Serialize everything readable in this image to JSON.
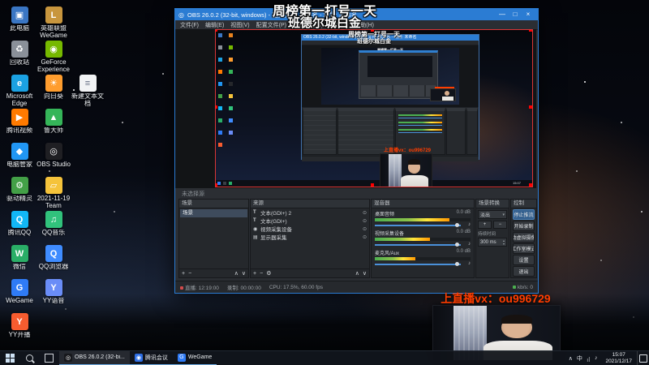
{
  "colors": {
    "accent_blue": "#2b7cd3",
    "vx_red": "#ff3d00",
    "live_red": "#d24b4b",
    "bitrate_green": "#4caf50"
  },
  "overlay": {
    "line1": "周榜第一打号一天",
    "line2": "班德尔城白金"
  },
  "vx": {
    "text": "上直播vx：ou996729"
  },
  "desktop": {
    "col1": [
      {
        "label": "此电脑",
        "glyph": "▣",
        "color": "#3a76c4"
      },
      {
        "label": "回收站",
        "glyph": "♻",
        "color": "#8a9099"
      },
      {
        "label": "Microsoft Edge",
        "glyph": "e",
        "color": "#1ba1e2"
      },
      {
        "label": "腾讯视频",
        "glyph": "▶",
        "color": "#ff7a00"
      },
      {
        "label": "电脑管家",
        "glyph": "◆",
        "color": "#2196f3"
      },
      {
        "label": "驱动精灵",
        "glyph": "⚙",
        "color": "#43a047"
      },
      {
        "label": "腾讯QQ",
        "glyph": "Q",
        "color": "#12b7f5"
      },
      {
        "label": "微信",
        "glyph": "W",
        "color": "#2aae67"
      },
      {
        "label": "WeGame",
        "glyph": "G",
        "color": "#2f7bf6"
      },
      {
        "label": "YY开播",
        "glyph": "Y",
        "color": "#f75c2f"
      }
    ],
    "col2": [
      {
        "label": "英雄联盟WeGame",
        "glyph": "L",
        "color": "#c8963e"
      },
      {
        "label": "GeForce Experience",
        "glyph": "◉",
        "color": "#76b900"
      },
      {
        "label": "向日葵",
        "glyph": "☀",
        "color": "#ff9d2e"
      },
      {
        "label": "鲁大师",
        "glyph": "▲",
        "color": "#35b559"
      },
      {
        "label": "OBS Studio",
        "glyph": "◎",
        "color": "#1f1f23"
      },
      {
        "label": "2021-11-19 Team",
        "glyph": "▱",
        "color": "#f5c33b"
      },
      {
        "label": "QQ音乐",
        "glyph": "♫",
        "color": "#31c27c"
      },
      {
        "label": "QQ浏览器",
        "glyph": "Q",
        "color": "#3f8cff"
      },
      {
        "label": "YY语音",
        "glyph": "Y",
        "color": "#6a8df7"
      }
    ],
    "col3": [
      {
        "label": "新建文本文档",
        "glyph": "≡",
        "color": "#f2f3f5"
      }
    ]
  },
  "obs": {
    "title": "OBS 26.0.2 (32-bit, windows) - 配置文件: 未命名 - 场景: 未命名",
    "logo_glyph": "◎",
    "window_buttons": {
      "min": "—",
      "max": "□",
      "close": "×"
    },
    "menu": [
      "文件(F)",
      "编辑(E)",
      "视图(V)",
      "配置文件(P)",
      "场景集合(S)",
      "工具(T)",
      "帮助(H)"
    ],
    "preview_hint": "未选择源",
    "scenes": {
      "title": "场景",
      "items": [
        {
          "name": "场景"
        }
      ]
    },
    "sources": {
      "title": "来源",
      "eye_glyph": "⊙",
      "items": [
        {
          "glyph": "T",
          "label": "文本(GDI+) 2"
        },
        {
          "glyph": "T",
          "label": "文本(GDI+)"
        },
        {
          "glyph": "◉",
          "label": "视频采集设备"
        },
        {
          "glyph": "▤",
          "label": "显示器采集"
        }
      ]
    },
    "mixer": {
      "title": "混音器",
      "speaker_glyph": "♪",
      "channels": [
        {
          "name": "桌面音频",
          "db": "0.0 dB"
        },
        {
          "name": "视频采集设备",
          "db": "0.0 dB"
        },
        {
          "name": "麦克风/Aux",
          "db": "0.0 dB"
        }
      ]
    },
    "transitions": {
      "title": "场景转换",
      "selected": "淡出",
      "caret": "▾",
      "add": "+",
      "remove": "−",
      "duration_label": "持续时间",
      "duration": "300 ms",
      "spin_up": "▴",
      "spin_down": "▾"
    },
    "controls": {
      "title": "控制",
      "buttons": [
        {
          "label": "停止推流"
        },
        {
          "label": "开始录制"
        },
        {
          "label": "启动虚拟摄像机"
        },
        {
          "label": "工作室模式"
        },
        {
          "label": "设置"
        },
        {
          "label": "退出"
        }
      ]
    },
    "toolbar_glyphs": {
      "add": "+",
      "remove": "−",
      "props": "⚙",
      "up": "∧",
      "down": "∨"
    },
    "status": {
      "live": "直播: 12:19:00",
      "rec": "录制: 00:00:00",
      "cpu": "CPU: 17.5%, 60.00 fps",
      "bitrate": "kb/s: 0"
    }
  },
  "taskbar": {
    "apps": [
      {
        "label": "OBS 26.0.2 (32-bi...",
        "glyph": "◎",
        "color": "#17181c"
      },
      {
        "label": "腾讯会议",
        "glyph": "◉",
        "color": "#2f6fe4"
      },
      {
        "label": "WeGame",
        "glyph": "G",
        "color": "#2f7bf6"
      }
    ],
    "tray": {
      "chevron": "∧",
      "ime": "中",
      "net": "⣴",
      "vol": "♪",
      "time": "15:07",
      "date": "2021/12/17"
    }
  }
}
